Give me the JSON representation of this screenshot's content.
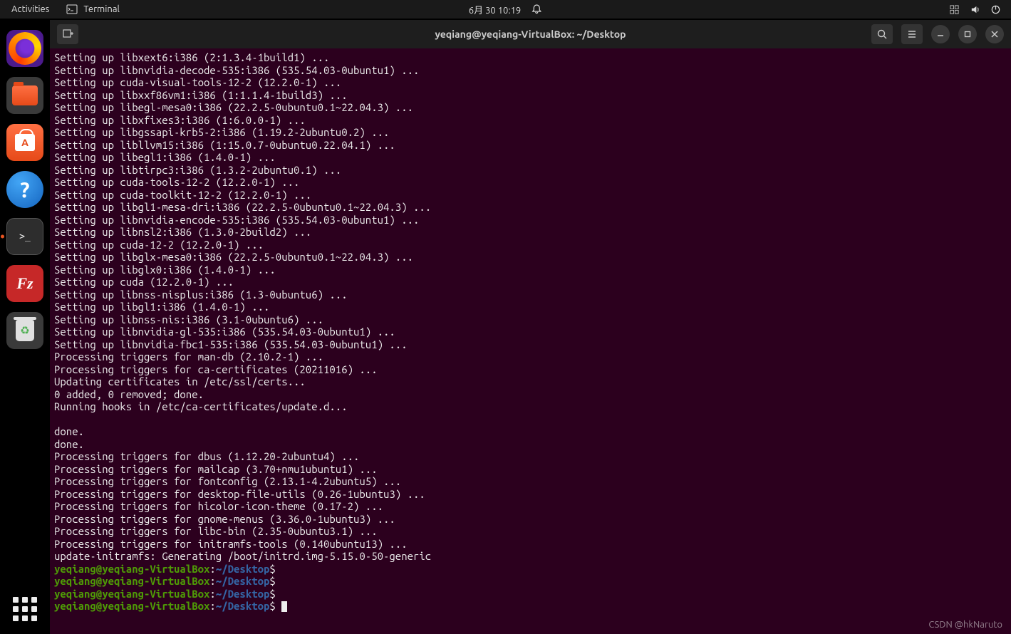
{
  "topbar": {
    "activities": "Activities",
    "app_name": "Terminal",
    "clock": "6月 30 10:19"
  },
  "window": {
    "title": "yeqiang@yeqiang-VirtualBox: ~/Desktop"
  },
  "prompt": {
    "userhost": "yeqiang@yeqiang-VirtualBox",
    "sep": ":",
    "path": "~/Desktop",
    "suffix": "$"
  },
  "lines": [
    "Setting up libxext6:i386 (2:1.3.4-1build1) ...",
    "Setting up libnvidia-decode-535:i386 (535.54.03-0ubuntu1) ...",
    "Setting up cuda-visual-tools-12-2 (12.2.0-1) ...",
    "Setting up libxxf86vm1:i386 (1:1.1.4-1build3) ...",
    "Setting up libegl-mesa0:i386 (22.2.5-0ubuntu0.1~22.04.3) ...",
    "Setting up libxfixes3:i386 (1:6.0.0-1) ...",
    "Setting up libgssapi-krb5-2:i386 (1.19.2-2ubuntu0.2) ...",
    "Setting up libllvm15:i386 (1:15.0.7-0ubuntu0.22.04.1) ...",
    "Setting up libegl1:i386 (1.4.0-1) ...",
    "Setting up libtirpc3:i386 (1.3.2-2ubuntu0.1) ...",
    "Setting up cuda-tools-12-2 (12.2.0-1) ...",
    "Setting up cuda-toolkit-12-2 (12.2.0-1) ...",
    "Setting up libgl1-mesa-dri:i386 (22.2.5-0ubuntu0.1~22.04.3) ...",
    "Setting up libnvidia-encode-535:i386 (535.54.03-0ubuntu1) ...",
    "Setting up libnsl2:i386 (1.3.0-2build2) ...",
    "Setting up cuda-12-2 (12.2.0-1) ...",
    "Setting up libglx-mesa0:i386 (22.2.5-0ubuntu0.1~22.04.3) ...",
    "Setting up libglx0:i386 (1.4.0-1) ...",
    "Setting up cuda (12.2.0-1) ...",
    "Setting up libnss-nisplus:i386 (1.3-0ubuntu6) ...",
    "Setting up libgl1:i386 (1.4.0-1) ...",
    "Setting up libnss-nis:i386 (3.1-0ubuntu6) ...",
    "Setting up libnvidia-gl-535:i386 (535.54.03-0ubuntu1) ...",
    "Setting up libnvidia-fbc1-535:i386 (535.54.03-0ubuntu1) ...",
    "Processing triggers for man-db (2.10.2-1) ...",
    "Processing triggers for ca-certificates (20211016) ...",
    "Updating certificates in /etc/ssl/certs...",
    "0 added, 0 removed; done.",
    "Running hooks in /etc/ca-certificates/update.d...",
    "",
    "done.",
    "done.",
    "Processing triggers for dbus (1.12.20-2ubuntu4) ...",
    "Processing triggers for mailcap (3.70+nmu1ubuntu1) ...",
    "Processing triggers for fontconfig (2.13.1-4.2ubuntu5) ...",
    "Processing triggers for desktop-file-utils (0.26-1ubuntu3) ...",
    "Processing triggers for hicolor-icon-theme (0.17-2) ...",
    "Processing triggers for gnome-menus (3.36.0-1ubuntu3) ...",
    "Processing triggers for libc-bin (2.35-0ubuntu3.1) ...",
    "Processing triggers for initramfs-tools (0.140ubuntu13) ...",
    "update-initramfs: Generating /boot/initrd.img-5.15.0-50-generic"
  ],
  "watermark": "CSDN @hkNaruto"
}
